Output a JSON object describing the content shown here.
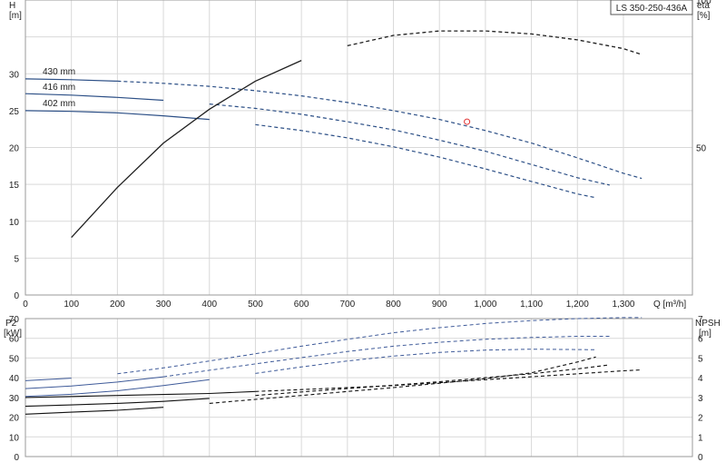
{
  "title": "LS 350-250-436A",
  "colors": {
    "head": "#2c4f86",
    "eta": "#1f1f1f",
    "power": "#3e5a99",
    "npsh": "#111111",
    "point": "#e03030",
    "grid": "#d9d9d9"
  },
  "top_labels": {
    "h_symbol": "H",
    "h_unit": "[m]",
    "eta_symbol": "eta",
    "eta_unit": "[%]",
    "q_label": "Q [m³/h]"
  },
  "bottom_labels": {
    "p_symbol": "P2",
    "p_unit": "[kW]",
    "npsh_symbol": "NPSH",
    "npsh_unit": "[m]"
  },
  "chart_data": [
    {
      "type": "line",
      "title": "LS 350-250-436A",
      "xlabel": "Q [m³/h]",
      "ylabel": "H [m]",
      "y2label": "eta [%]",
      "xlim": [
        0,
        1450
      ],
      "ylim": [
        0,
        40
      ],
      "y2lim": [
        0,
        100
      ],
      "grid": true,
      "x_ticks": [
        "0",
        "100",
        "200",
        "300",
        "400",
        "500",
        "600",
        "700",
        "800",
        "900",
        "1,000",
        "1,100",
        "1,200",
        "1,300"
      ],
      "y_ticks": [
        "0",
        "5",
        "10",
        "15",
        "20",
        "25",
        "30"
      ],
      "y2_ticks": [
        "50",
        "100"
      ],
      "series": [
        {
          "name": "430 mm",
          "axis": "H",
          "x": [
            0,
            100,
            200,
            300,
            400,
            500,
            600,
            700,
            800,
            900,
            1000,
            1100,
            1200,
            1300,
            1340
          ],
          "y": [
            29.3,
            29.2,
            29.0,
            28.7,
            28.3,
            27.7,
            27.0,
            26.1,
            25.0,
            23.8,
            22.3,
            20.6,
            18.6,
            16.5,
            15.8
          ]
        },
        {
          "name": "416 mm",
          "axis": "H",
          "x": [
            0,
            100,
            200,
            300,
            400,
            500,
            600,
            700,
            800,
            900,
            1000,
            1100,
            1200,
            1270
          ],
          "y": [
            27.3,
            27.1,
            26.8,
            26.4,
            25.9,
            25.3,
            24.5,
            23.5,
            22.4,
            21.0,
            19.5,
            17.7,
            15.9,
            14.9
          ]
        },
        {
          "name": "402 mm",
          "axis": "H",
          "x": [
            0,
            100,
            200,
            300,
            400,
            500,
            600,
            700,
            800,
            900,
            1000,
            1100,
            1200,
            1240
          ],
          "y": [
            25.0,
            24.9,
            24.7,
            24.3,
            23.8,
            23.1,
            22.3,
            21.3,
            20.1,
            18.7,
            17.1,
            15.4,
            13.7,
            13.2
          ]
        },
        {
          "name": "",
          "axis": "eta",
          "x": [
            100,
            200,
            300,
            400,
            500,
            600,
            700,
            800,
            900,
            1000,
            1100,
            1200,
            1300,
            1340
          ],
          "y": [
            19.5,
            36.5,
            51.5,
            63,
            72.5,
            79.5,
            84.5,
            88,
            89.5,
            89.5,
            88.5,
            86.5,
            83.5,
            81.5
          ]
        }
      ],
      "operating_point": {
        "x": 960,
        "y": 23.5
      },
      "annotations": [
        "430 mm",
        "416 mm",
        "402 mm"
      ]
    },
    {
      "type": "line",
      "ylabel": "P2 [kW]",
      "y2label": "NPSH [m]",
      "xlim": [
        0,
        1450
      ],
      "ylim": [
        0,
        70
      ],
      "y2lim": [
        0,
        7
      ],
      "grid": true,
      "y_ticks": [
        "0",
        "10",
        "20",
        "30",
        "40",
        "50",
        "60",
        "70"
      ],
      "y2_ticks": [
        "0",
        "1",
        "2",
        "3",
        "4",
        "5",
        "6",
        "7"
      ],
      "series": [
        {
          "name": "",
          "axis": "P2",
          "x": [
            0,
            100,
            200,
            300,
            400,
            500,
            600,
            700,
            800,
            900,
            1000,
            1100,
            1200,
            1300,
            1340
          ],
          "y": [
            38.5,
            39.8,
            42,
            45,
            48.5,
            52.2,
            56,
            59.5,
            62.8,
            65.4,
            67.5,
            69,
            70,
            70.5,
            70.5
          ]
        },
        {
          "name": "",
          "axis": "P2",
          "x": [
            0,
            100,
            200,
            300,
            400,
            500,
            600,
            700,
            800,
            900,
            1000,
            1100,
            1200,
            1270
          ],
          "y": [
            34.5,
            35.8,
            37.8,
            40.5,
            43.8,
            47,
            50.2,
            53.3,
            56,
            58,
            59.5,
            60.4,
            61,
            61
          ]
        },
        {
          "name": "",
          "axis": "P2",
          "x": [
            0,
            100,
            200,
            300,
            400,
            500,
            600,
            700,
            800,
            900,
            1000,
            1100,
            1200,
            1240
          ],
          "y": [
            30.5,
            31.6,
            33.4,
            36,
            39,
            42.2,
            45.5,
            48.5,
            51,
            52.8,
            54,
            54.5,
            54.3,
            54.2
          ]
        },
        {
          "name": "",
          "axis": "NPSH",
          "x": [
            0,
            100,
            200,
            300,
            400,
            500,
            600,
            700,
            800,
            900,
            1000,
            1100,
            1200,
            1300,
            1340
          ],
          "y": [
            3.0,
            3.05,
            3.1,
            3.15,
            3.2,
            3.3,
            3.4,
            3.5,
            3.6,
            3.75,
            3.9,
            4.05,
            4.2,
            4.35,
            4.4
          ]
        },
        {
          "name": "",
          "axis": "NPSH",
          "x": [
            0,
            100,
            200,
            300,
            400,
            500,
            600,
            700,
            800,
            900,
            1000,
            1100,
            1200,
            1270
          ],
          "y": [
            2.55,
            2.62,
            2.7,
            2.8,
            2.95,
            3.1,
            3.28,
            3.45,
            3.62,
            3.8,
            4.0,
            4.2,
            4.45,
            4.65
          ]
        },
        {
          "name": "",
          "axis": "NPSH",
          "x": [
            0,
            100,
            200,
            300,
            400,
            500,
            600,
            700,
            800,
            900,
            1000,
            1100,
            1200,
            1240
          ],
          "y": [
            2.15,
            2.25,
            2.35,
            2.5,
            2.7,
            2.9,
            3.1,
            3.3,
            3.5,
            3.72,
            3.95,
            4.25,
            4.8,
            5.05
          ]
        }
      ]
    }
  ]
}
